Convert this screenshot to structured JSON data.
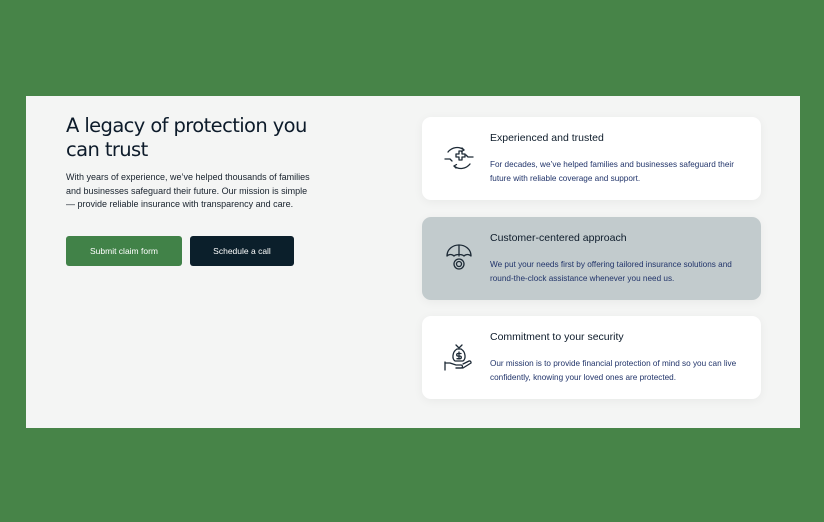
{
  "hero": {
    "title": "A legacy of protection you can trust",
    "description": "With years of experience, we’ve helped thousands of families and businesses safeguard their future. Our mission is simple — provide reliable insurance with transparency and care.",
    "claim_button": "Submit claim form",
    "call_button": "Schedule a call"
  },
  "cards": [
    {
      "icon": "hands-medical-cross-icon",
      "title": "Experienced and trusted",
      "text": "For decades, we’ve helped families and businesses safeguard their future with reliable coverage and support."
    },
    {
      "icon": "umbrella-coin-icon",
      "title": "Customer-centered approach",
      "text": "We put your needs first by offering tailored insurance solutions and round-the-clock assistance whenever you need us."
    },
    {
      "icon": "hand-money-bag-icon",
      "title": "Commitment to your security",
      "text": "Our mission is to provide financial protection of mind so you can live confidently, knowing your loved ones are protected."
    }
  ],
  "colors": {
    "background": "#478448",
    "panel": "#f4f5f4",
    "primary_button": "#418248",
    "secondary_button": "#0b1f2b",
    "highlight_card": "#c2cbcd"
  }
}
